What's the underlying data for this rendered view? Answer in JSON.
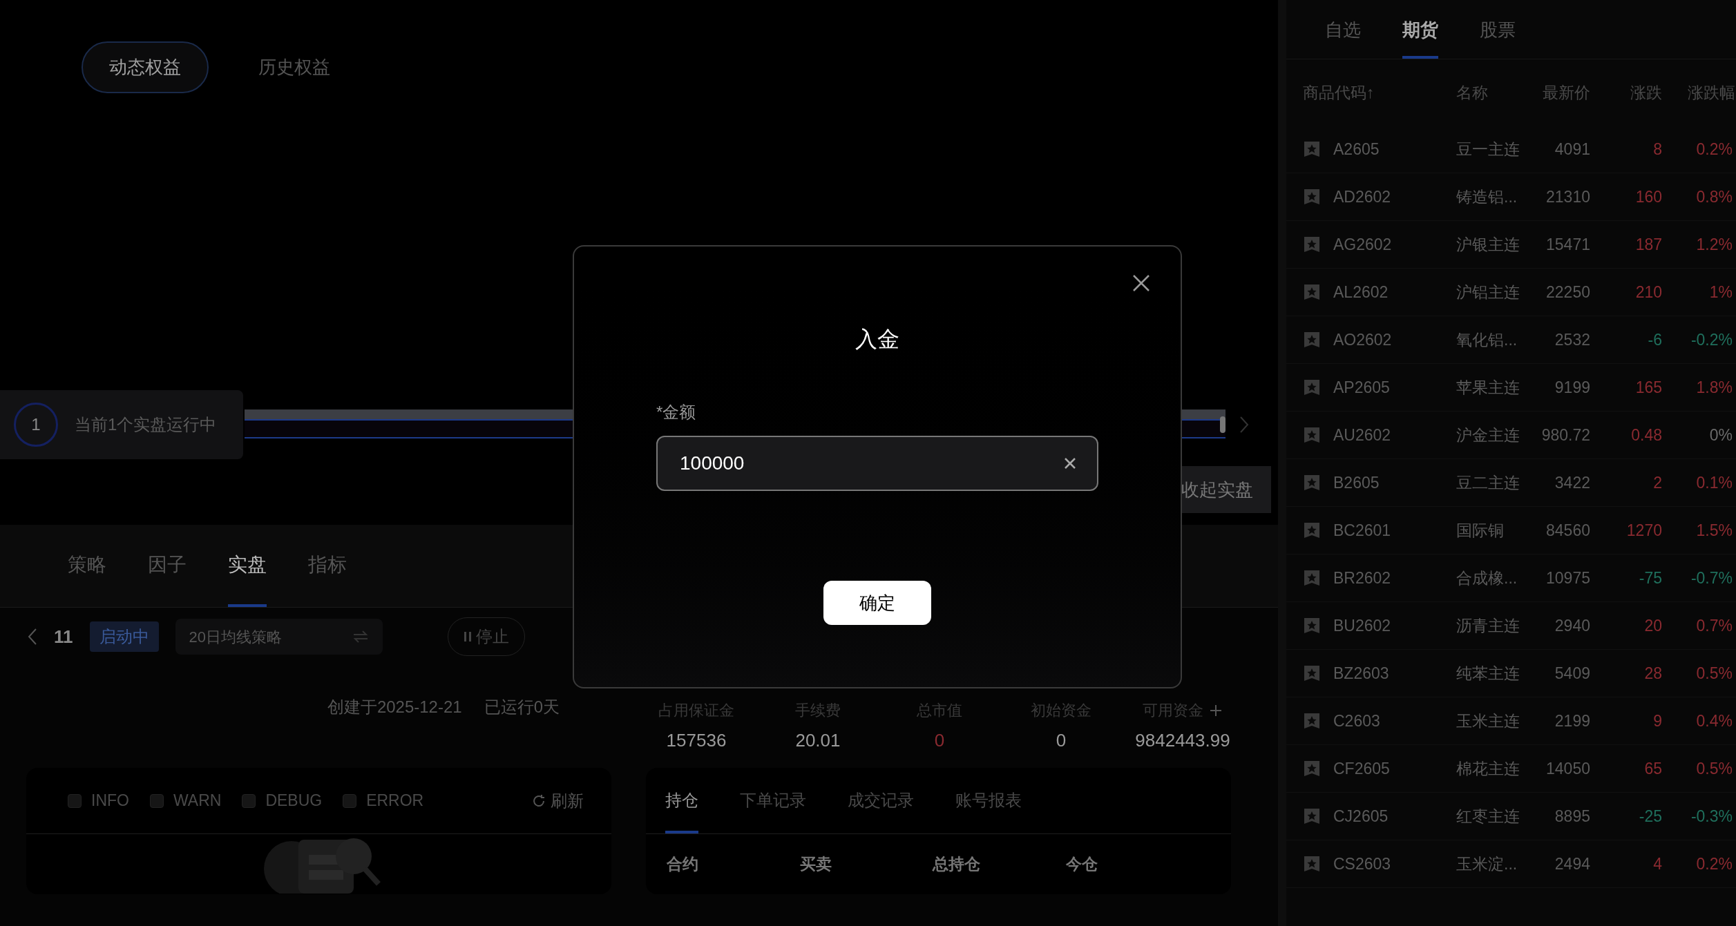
{
  "chart_tabs": [
    {
      "label": "动态权益",
      "selected": true
    },
    {
      "label": "历史权益",
      "selected": false
    }
  ],
  "running": {
    "count": "1",
    "text": "当前1个实盘运行中"
  },
  "range_bar": {
    "level": 1
  },
  "collapse_button": "收起实盘",
  "section_tabs": [
    {
      "label": "策略",
      "selected": false
    },
    {
      "label": "因子",
      "selected": false
    },
    {
      "label": "实盘",
      "selected": true
    },
    {
      "label": "指标",
      "selected": false
    }
  ],
  "strategy": {
    "id": "11",
    "status": "启动中",
    "name": "20日均线策略",
    "stop_button": "停止",
    "created": "创建于2025-12-21",
    "running_days": "已运行0天"
  },
  "stats": [
    {
      "label": "占用保证金",
      "value": "157536"
    },
    {
      "label": "手续费",
      "value": "20.01"
    },
    {
      "label": "总市值",
      "value": "0",
      "color": "#8a2a30"
    },
    {
      "label": "初始资金",
      "value": "0"
    },
    {
      "label": "可用资金",
      "value": "9842443.99",
      "add": true
    }
  ],
  "log_panel": {
    "levels": [
      {
        "label": "INFO",
        "checked": false
      },
      {
        "label": "WARN",
        "checked": false
      },
      {
        "label": "DEBUG",
        "checked": false
      },
      {
        "label": "ERROR",
        "checked": false
      }
    ],
    "refresh": "刷新"
  },
  "positions_panel": {
    "tabs": [
      {
        "label": "持仓",
        "selected": true
      },
      {
        "label": "下单记录",
        "selected": false
      },
      {
        "label": "成交记录",
        "selected": false
      },
      {
        "label": "账号报表",
        "selected": false
      }
    ],
    "columns": [
      "合约",
      "买卖",
      "总持仓",
      "今仓"
    ]
  },
  "market": {
    "tabs": [
      {
        "label": "自选",
        "selected": false
      },
      {
        "label": "期货",
        "selected": true
      },
      {
        "label": "股票",
        "selected": false
      }
    ],
    "columns": [
      "商品代码↑",
      "名称",
      "最新价",
      "涨跌",
      "涨跌幅"
    ],
    "rows": [
      {
        "code": "A2605",
        "name": "豆一主连",
        "price": "4091",
        "change": {
          "text": "8",
          "color": "#8a2a30"
        },
        "pct": {
          "text": "0.2%",
          "color": "#8a2a30"
        }
      },
      {
        "code": "AD2602",
        "name": "铸造铝...",
        "price": "21310",
        "change": {
          "text": "160",
          "color": "#8a2a30"
        },
        "pct": {
          "text": "0.8%",
          "color": "#8a2a30"
        }
      },
      {
        "code": "AG2602",
        "name": "沪银主连",
        "price": "15471",
        "change": {
          "text": "187",
          "color": "#8a2a30"
        },
        "pct": {
          "text": "1.2%",
          "color": "#8a2a30"
        }
      },
      {
        "code": "AL2602",
        "name": "沪铝主连",
        "price": "22250",
        "change": {
          "text": "210",
          "color": "#8a2a30"
        },
        "pct": {
          "text": "1%",
          "color": "#8a2a30"
        }
      },
      {
        "code": "AO2602",
        "name": "氧化铝...",
        "price": "2532",
        "change": {
          "text": "-6",
          "color": "#1f6f5c"
        },
        "pct": {
          "text": "-0.2%",
          "color": "#1f6f5c"
        }
      },
      {
        "code": "AP2605",
        "name": "苹果主连",
        "price": "9199",
        "change": {
          "text": "165",
          "color": "#8a2a30"
        },
        "pct": {
          "text": "1.8%",
          "color": "#8a2a30"
        }
      },
      {
        "code": "AU2602",
        "name": "沪金主连",
        "price": "980.72",
        "change": {
          "text": "0.48",
          "color": "#8a2a30"
        },
        "pct": {
          "text": "0%",
          "color": "#6a6a6a"
        }
      },
      {
        "code": "B2605",
        "name": "豆二主连",
        "price": "3422",
        "change": {
          "text": "2",
          "color": "#8a2a30"
        },
        "pct": {
          "text": "0.1%",
          "color": "#8a2a30"
        }
      },
      {
        "code": "BC2601",
        "name": "国际铜",
        "price": "84560",
        "change": {
          "text": "1270",
          "color": "#8a2a30"
        },
        "pct": {
          "text": "1.5%",
          "color": "#8a2a30"
        }
      },
      {
        "code": "BR2602",
        "name": "合成橡...",
        "price": "10975",
        "change": {
          "text": "-75",
          "color": "#1f6f5c"
        },
        "pct": {
          "text": "-0.7%",
          "color": "#1f6f5c"
        }
      },
      {
        "code": "BU2602",
        "name": "沥青主连",
        "price": "2940",
        "change": {
          "text": "20",
          "color": "#8a2a30"
        },
        "pct": {
          "text": "0.7%",
          "color": "#8a2a30"
        }
      },
      {
        "code": "BZ2603",
        "name": "纯苯主连",
        "price": "5409",
        "change": {
          "text": "28",
          "color": "#8a2a30"
        },
        "pct": {
          "text": "0.5%",
          "color": "#8a2a30"
        }
      },
      {
        "code": "C2603",
        "name": "玉米主连",
        "price": "2199",
        "change": {
          "text": "9",
          "color": "#8a2a30"
        },
        "pct": {
          "text": "0.4%",
          "color": "#8a2a30"
        }
      },
      {
        "code": "CF2605",
        "name": "棉花主连",
        "price": "14050",
        "change": {
          "text": "65",
          "color": "#8a2a30"
        },
        "pct": {
          "text": "0.5%",
          "color": "#8a2a30"
        }
      },
      {
        "code": "CJ2605",
        "name": "红枣主连",
        "price": "8895",
        "change": {
          "text": "-25",
          "color": "#1f6f5c"
        },
        "pct": {
          "text": "-0.3%",
          "color": "#1f6f5c"
        }
      },
      {
        "code": "CS2603",
        "name": "玉米淀...",
        "price": "2494",
        "change": {
          "text": "4",
          "color": "#8a2a30"
        },
        "pct": {
          "text": "0.2%",
          "color": "#8a2a30"
        }
      }
    ]
  },
  "dialog": {
    "title": "入金",
    "field_label": "*金额",
    "value": "100000",
    "confirm": "确定"
  }
}
